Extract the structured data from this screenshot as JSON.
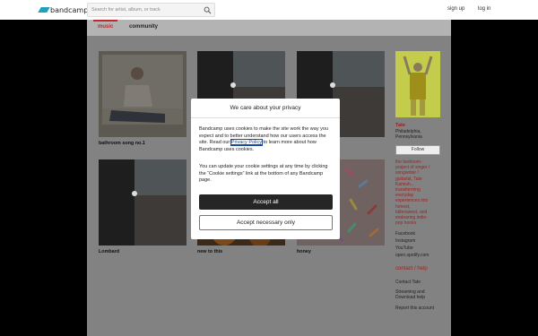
{
  "header": {
    "logo_text": "bandcamp",
    "search_placeholder": "Search for artist, album, or track",
    "signup": "sign up",
    "login": "log in"
  },
  "nav": {
    "tabs": [
      "music",
      "community"
    ]
  },
  "albums": [
    {
      "title": "bathroom song no.1"
    },
    {
      "title": ""
    },
    {
      "title": ""
    },
    {
      "title": "Lombard"
    },
    {
      "title": "new to this"
    },
    {
      "title": "honey"
    }
  ],
  "sidebar": {
    "artist": "Tate",
    "location_line1": "Philadelphia,",
    "location_line2": "Pennsylvania",
    "follow": "Follow",
    "bio": [
      "the bedroom-",
      "project of singer /",
      "songwriter /",
      "guitarist, Tate",
      "Kamish...",
      "transforming",
      "everyday",
      "experiences into",
      "honest,",
      "bittersweet, and",
      "endearing indie-",
      "pop hooks"
    ],
    "links": [
      "Facebook",
      "Instagram",
      "YouTube",
      "open.spotify.com"
    ],
    "contact": "contact / help",
    "contact_links": [
      "Contact Tate",
      "Streaming and",
      "Download help",
      "Report this account"
    ]
  },
  "cookie_modal": {
    "title": "We care about your privacy",
    "p1_before": "Bandcamp uses cookies to make the site work the way you expect and to better understand how our users access the site. Read our ",
    "privacy_link": "Privacy Policy",
    "p1_after": " to learn more about how Bandcamp uses cookies.",
    "p2": "You can update your cookie settings at any time by clicking the “Cookie settings” link at the bottom of any Bandcamp page.",
    "accept_all": "Accept all",
    "accept_necessary": "Accept necessary only"
  },
  "colors": {
    "accent": "#c0282d",
    "link_red": "#a0201f",
    "logo": "#1da0c3"
  }
}
